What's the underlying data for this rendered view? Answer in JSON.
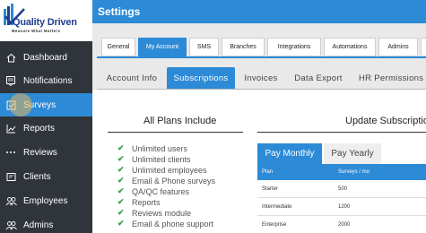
{
  "brand": {
    "name": "Quality Driven",
    "tagline": "Measure What Matters"
  },
  "header": {
    "title": "Settings"
  },
  "sidebar": {
    "items": [
      {
        "label": "Dashboard",
        "icon": "home-icon",
        "active": false
      },
      {
        "label": "Notifications",
        "icon": "bell-icon",
        "active": false
      },
      {
        "label": "Surveys",
        "icon": "checkbox-icon",
        "active": true
      },
      {
        "label": "Reports",
        "icon": "chart-icon",
        "active": false
      },
      {
        "label": "Reviews",
        "icon": "dots-icon",
        "active": false
      },
      {
        "label": "Clients",
        "icon": "card-icon",
        "active": false
      },
      {
        "label": "Employees",
        "icon": "users-icon",
        "active": false
      },
      {
        "label": "Admins",
        "icon": "users-icon",
        "active": false
      }
    ]
  },
  "top_tabs": [
    "General",
    "My Account",
    "SMS",
    "Branches",
    "Integrations",
    "Automations",
    "Admins"
  ],
  "top_tabs_active": "My Account",
  "sub_tabs": [
    "Account Info",
    "Subscriptions",
    "Invoices",
    "Data Export",
    "HR Permissions"
  ],
  "sub_tabs_active": "Subscriptions",
  "plans": {
    "title": "All Plans Include",
    "features": [
      "Unlimited users",
      "Unlimited clients",
      "Unlimited employees",
      "Email & Phone surveys",
      "QA/QC features",
      "Reports",
      "Reviews module",
      "Email & phone support"
    ]
  },
  "update": {
    "title": "Update Subscription",
    "pay_tabs": [
      "Pay Monthly",
      "Pay Yearly"
    ],
    "pay_active": "Pay Monthly",
    "table": {
      "headers": [
        "Plan",
        "Surveys / mo"
      ],
      "rows": [
        [
          "Starter",
          "500"
        ],
        [
          "Intermediate",
          "1200"
        ],
        [
          "Enterprise",
          "2000"
        ]
      ]
    }
  },
  "colors": {
    "accent": "#2c8ad6",
    "sidebar": "#2f353a",
    "check": "#3aa142"
  }
}
